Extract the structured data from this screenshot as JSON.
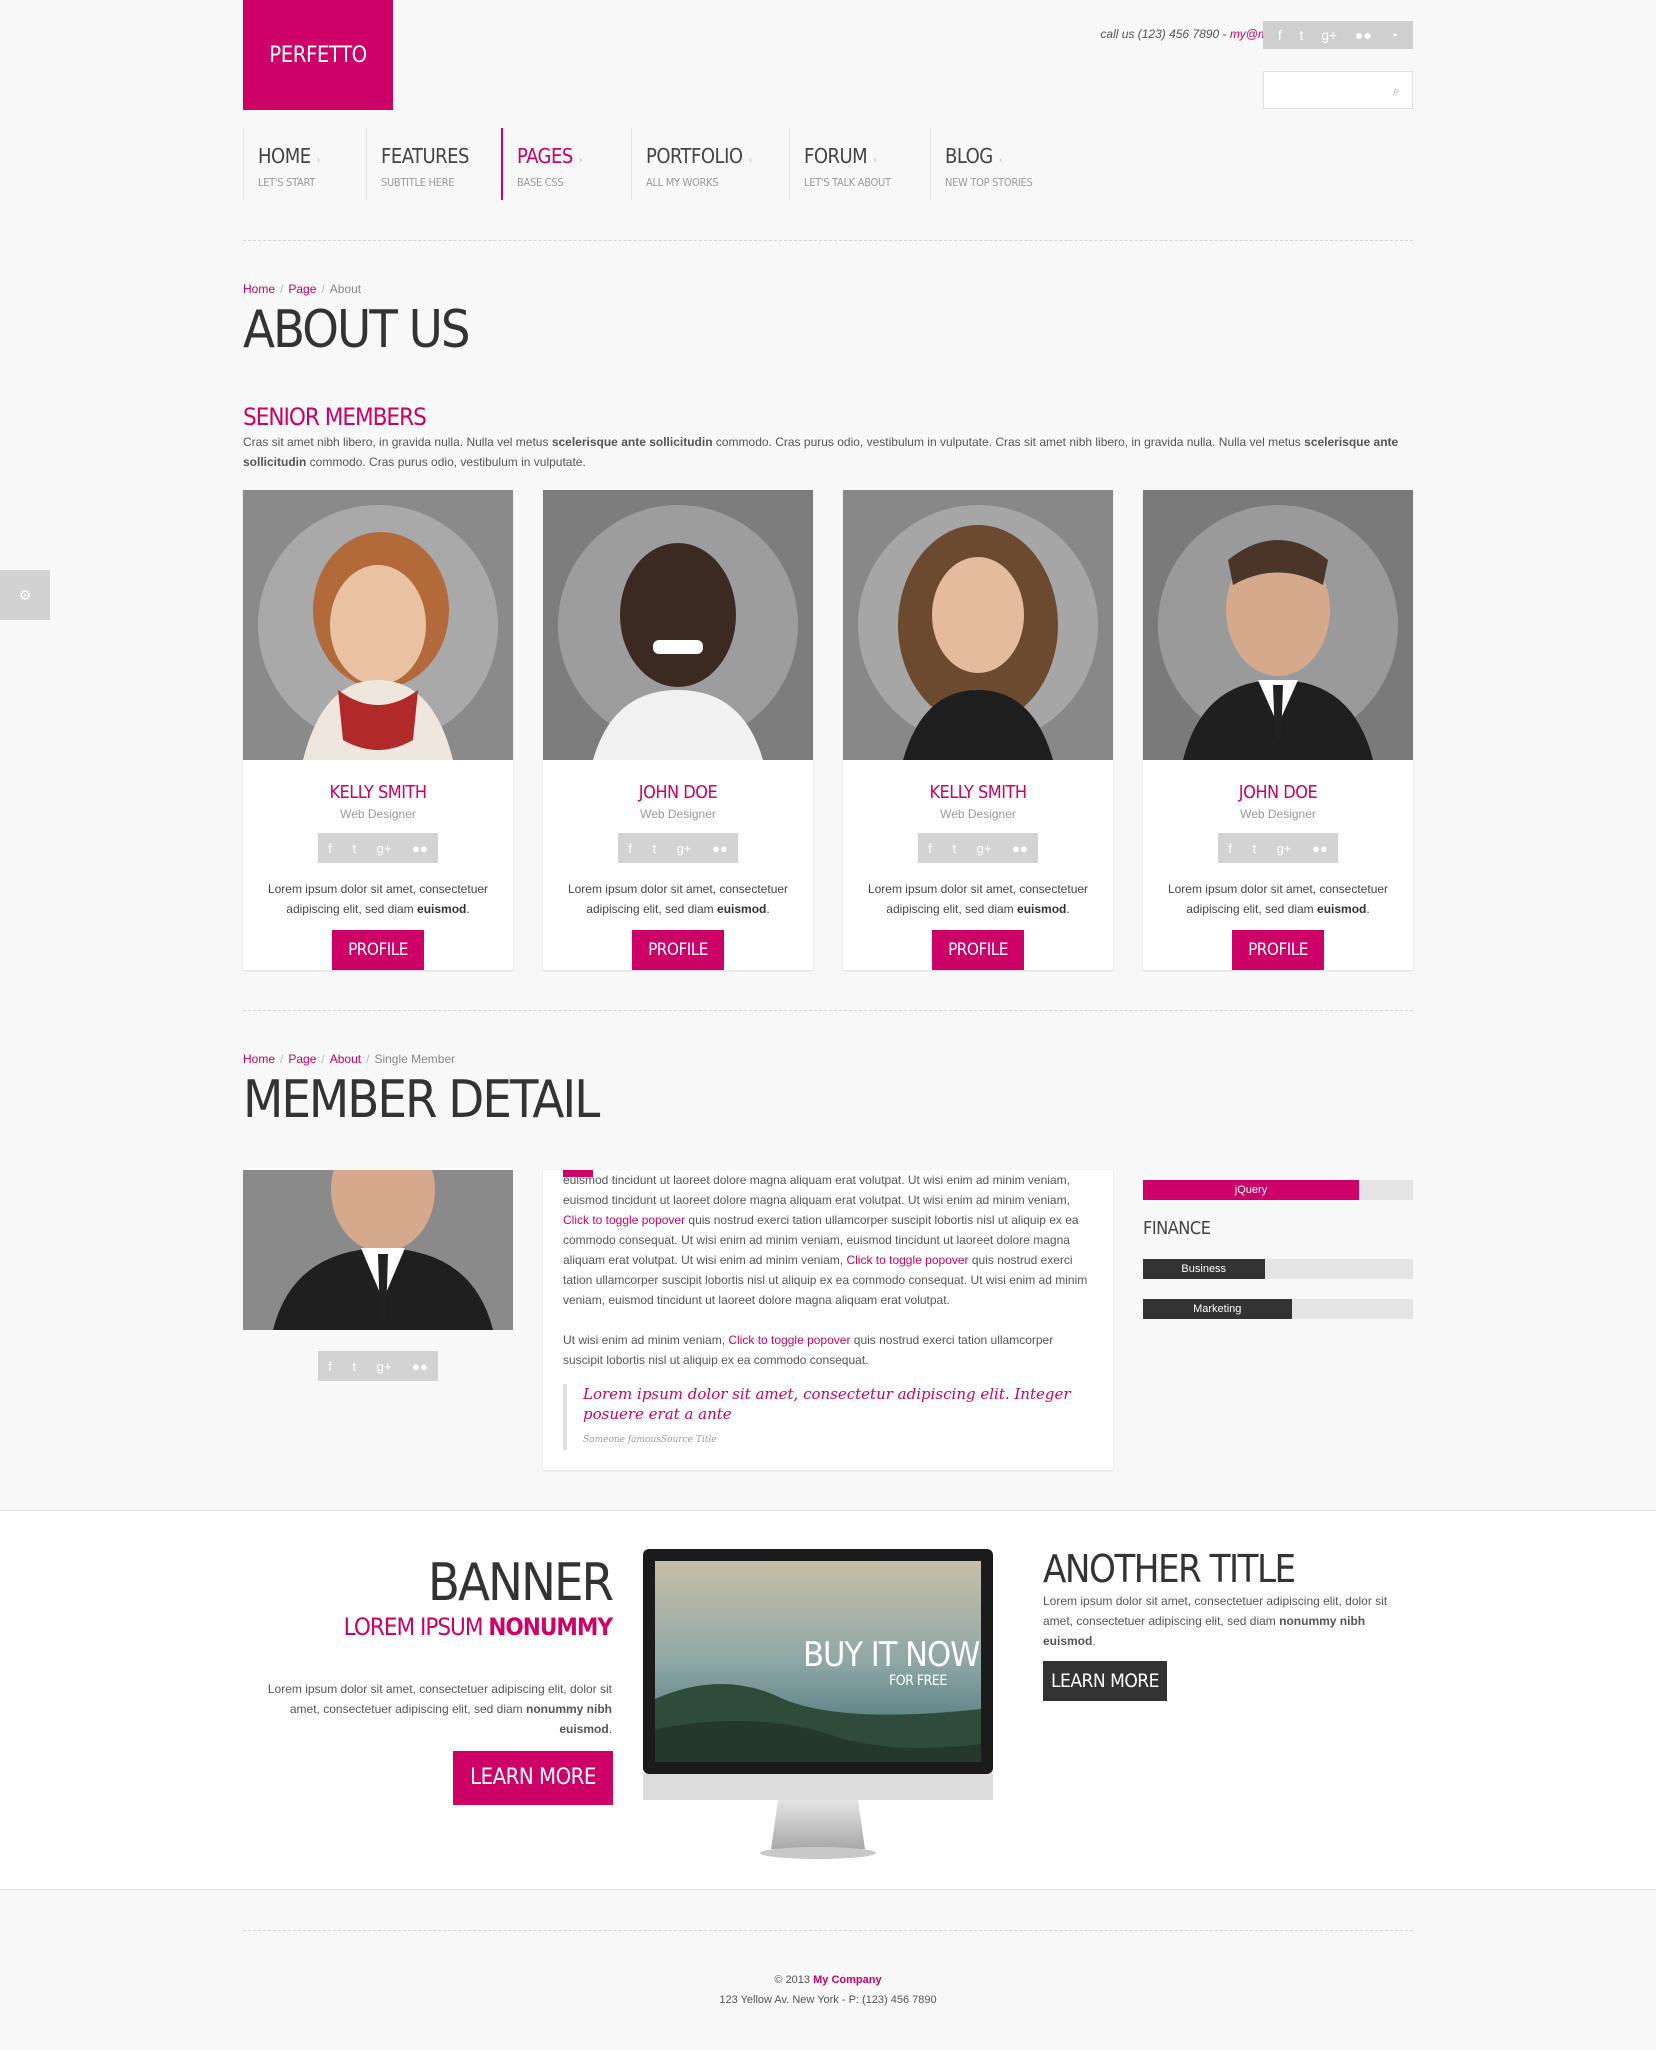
{
  "brand": {
    "logo": "PERFETTO",
    "accent": "#cc0066"
  },
  "header": {
    "call": "call us (123) 456 7890 - ",
    "email": "my@mail.com",
    "social_icons": [
      "facebook-icon",
      "twitter-icon",
      "google-plus-icon",
      "flickr-icon",
      "rss-icon"
    ]
  },
  "nav": [
    {
      "title": "HOME",
      "sub": "LET'S START"
    },
    {
      "title": "FEATURES",
      "sub": "SUBTITLE HERE"
    },
    {
      "title": "PAGES",
      "sub": "BASE CSS"
    },
    {
      "title": "PORTFOLIO",
      "sub": "ALL MY WORKS"
    },
    {
      "title": "FORUM",
      "sub": "LET'S TALK ABOUT"
    },
    {
      "title": "BLOG",
      "sub": "NEW TOP STORIES"
    }
  ],
  "about": {
    "breadcrumb": [
      "Home",
      "Page",
      "About"
    ],
    "title": "ABOUT US",
    "section": "SENIOR MEMBERS",
    "intro_1": "Cras sit amet nibh libero, in gravida nulla. Nulla vel metus ",
    "intro_b1": "scelerisque ante sollicitudin",
    "intro_2": " commodo. Cras purus odio, vestibulum in vulputate. Cras sit amet nibh libero, in gravida nulla. Nulla vel metus ",
    "intro_b2": "scelerisque ante sollicitudin",
    "intro_3": " commodo. Cras purus odio, vestibulum in vulputate."
  },
  "members": [
    {
      "name": "KELLY SMITH",
      "role": "Web Designer",
      "text": "Lorem ipsum dolor sit amet, consectetuer adipiscing elit, sed diam ",
      "bold": "euismod",
      "button": "PROFILE"
    },
    {
      "name": "JOHN DOE",
      "role": "Web Designer",
      "text": "Lorem ipsum dolor sit amet, consectetuer adipiscing elit, sed diam ",
      "bold": "euismod",
      "button": "PROFILE"
    },
    {
      "name": "KELLY SMITH",
      "role": "Web Designer",
      "text": "Lorem ipsum dolor sit amet, consectetuer adipiscing elit, sed diam ",
      "bold": "euismod",
      "button": "PROFILE"
    },
    {
      "name": "JOHN DOE",
      "role": "Web Designer",
      "text": "Lorem ipsum dolor sit amet, consectetuer adipiscing elit, sed diam ",
      "bold": "euismod",
      "button": "PROFILE"
    }
  ],
  "detail": {
    "breadcrumb": [
      "Home",
      "Page",
      "About",
      "Single Member"
    ],
    "title": "MEMBER DETAIL",
    "p1_a": "euismod tincidunt ut laoreet dolore magna aliquam erat volutpat. Ut wisi enim ad minim veniam, euismod tincidunt ut laoreet dolore magna aliquam erat volutpat. Ut wisi enim ad minim veniam, ",
    "link1": "Click to toggle popover",
    "p1_b": " quis nostrud exerci tation ullamcorper suscipit lobortis nisl ut aliquip ex ea commodo consequat. Ut wisi enim ad minim veniam, euismod tincidunt ut laoreet dolore magna aliquam erat volutpat. Ut wisi enim ad minim veniam, ",
    "link2": "Click to toggle popover",
    "p1_c": " quis nostrud exerci tation ullamcorper suscipit lobortis nisl ut aliquip ex ea commodo consequat. Ut wisi enim ad minim veniam, euismod tincidunt ut laoreet dolore magna aliquam erat volutpat.",
    "p2_a": "Ut wisi enim ad minim veniam, ",
    "link3": "Click to toggle popover",
    "p2_b": " quis nostrud exerci tation ullamcorper suscipit lobortis nisl ut aliquip ex ea commodo consequat.",
    "quote": "Lorem ipsum dolor sit amet, consectetur adipiscing elit. Integer posuere erat a ante",
    "quote_source": "Someone famousSource Title"
  },
  "skills": {
    "bar1": {
      "label": "jQuery",
      "value": 0.8,
      "color": "#cc0066"
    },
    "group": "FINANCE",
    "bar2": {
      "label": "Business",
      "value": 0.45,
      "color": "#333333"
    },
    "bar3": {
      "label": "Marketing",
      "value": 0.55,
      "color": "#333333"
    }
  },
  "banner": {
    "title": "BANNER",
    "sub_a": "LOREM IPSUM ",
    "sub_b": "NONUMMY",
    "text_a": "Lorem ipsum dolor sit amet, consectetuer adipiscing elit, dolor sit amet, consectetuer adipiscing elit, sed diam ",
    "text_b": "nonummy nibh euismod",
    "text_c": ".",
    "button": "LEARN MORE",
    "screen_title": "BUY IT NOW",
    "screen_sub": "FOR FREE",
    "another_title": "ANOTHER TITLE",
    "another_text_a": "Lorem ipsum dolor sit amet, consectetuer adipiscing elit, dolor sit amet, consectetuer adipiscing elit, sed diam ",
    "another_text_b": "nonummy nibh euismod",
    "another_text_c": ".",
    "another_button": "LEARN MORE"
  },
  "footer": {
    "copy": "© 2013 ",
    "company": "My Company",
    "address": "123 Yellow Av. New York - P: (123) 456 7890"
  }
}
